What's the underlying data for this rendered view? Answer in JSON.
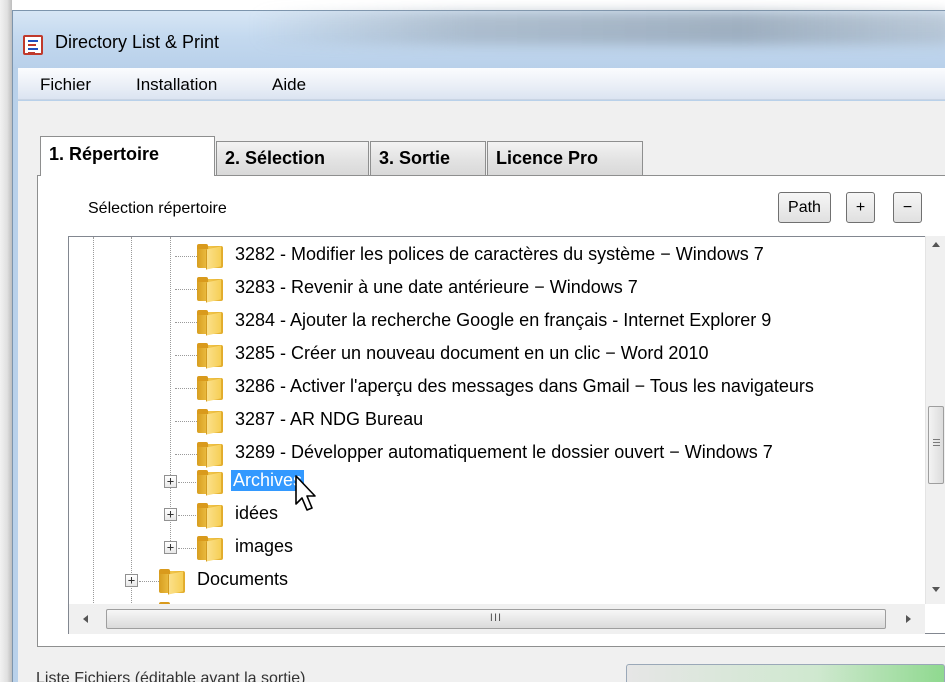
{
  "window": {
    "title": "Directory List & Print"
  },
  "menu": [
    {
      "label": "Fichier"
    },
    {
      "label": "Installation"
    },
    {
      "label": "Aide"
    }
  ],
  "tabs": [
    {
      "label": "1. Répertoire",
      "active": true
    },
    {
      "label": "2. Sélection",
      "active": false
    },
    {
      "label": "3. Sortie",
      "active": false
    },
    {
      "label": "Licence Pro",
      "active": false
    }
  ],
  "selection": {
    "label": "Sélection répertoire",
    "path_button": "Path",
    "plus_button": "+",
    "minus_button": "−"
  },
  "tree": {
    "items": [
      {
        "label": "3282 - Modifier les polices de caractères du système − Windows 7"
      },
      {
        "label": "3283 - Revenir à une date antérieure − Windows 7"
      },
      {
        "label": "3284 - Ajouter la recherche Google en français - Internet Explorer 9"
      },
      {
        "label": "3285 - Créer un nouveau document en un clic − Word 2010"
      },
      {
        "label": "3286 - Activer l'aperçu des messages dans Gmail − Tous les navigateurs"
      },
      {
        "label": "3287 - AR NDG Bureau"
      },
      {
        "label": "3289 - Développer automatiquement le dossier ouvert − Windows 7"
      },
      {
        "label": "Archives",
        "selected": true,
        "expander": "+"
      },
      {
        "label": "idées",
        "expander": "+"
      },
      {
        "label": "images",
        "expander": "+"
      },
      {
        "label": "Documents",
        "expander": "+"
      }
    ]
  },
  "hscroll": {
    "grip": "III"
  },
  "footer": {
    "label": "Liste Fichiers (éditable avant la sortie)"
  },
  "colors": {
    "selection": "#3399ff",
    "tab_border": "#8e8f8f",
    "window_frame": "#b9d1ea"
  }
}
